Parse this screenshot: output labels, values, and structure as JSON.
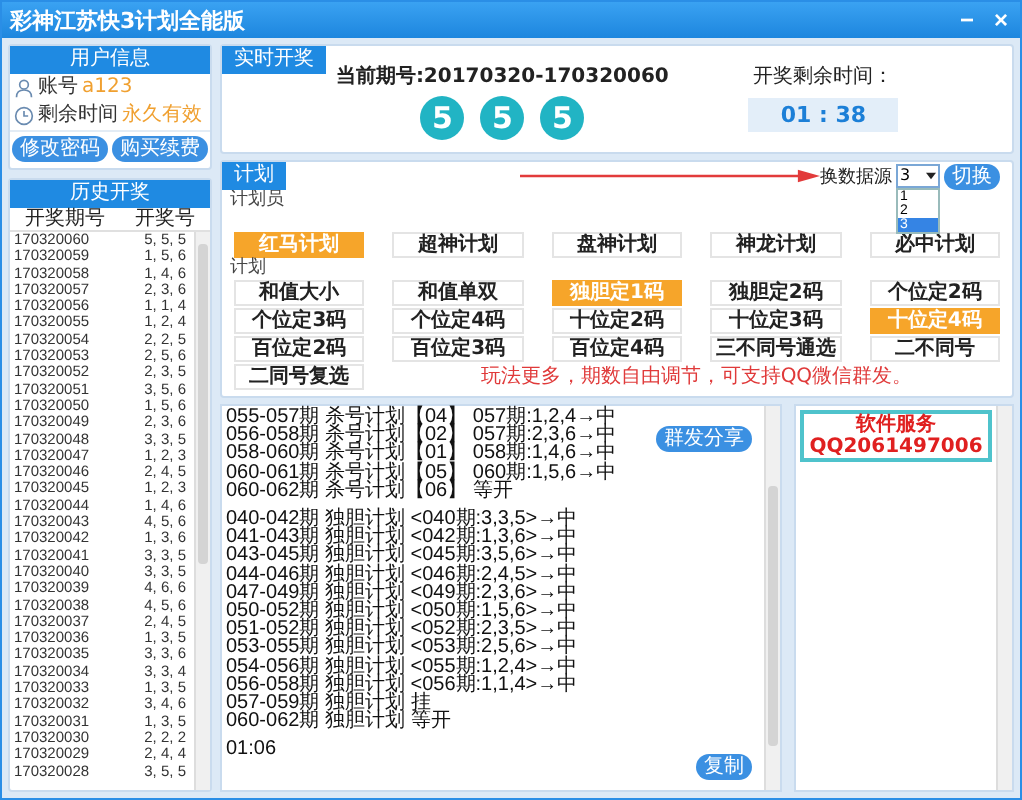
{
  "window": {
    "title": "彩神江苏快3计划全能版",
    "controls": [
      "−",
      "×"
    ]
  },
  "user_info": {
    "title": "用户信息",
    "fields": [
      {
        "kind": "user",
        "label": "账号",
        "value": "a123"
      },
      {
        "kind": "clock",
        "label": "剩余时间",
        "value": "永久有效"
      }
    ],
    "buttons": [
      "修改密码",
      "购买续费"
    ]
  },
  "history": {
    "title": "历史开奖",
    "columns": [
      "开奖期号",
      "开奖号"
    ],
    "rows": [
      [
        "170320060",
        "5, 5, 5"
      ],
      [
        "170320059",
        "1, 5, 6"
      ],
      [
        "170320058",
        "1, 4, 6"
      ],
      [
        "170320057",
        "2, 3, 6"
      ],
      [
        "170320056",
        "1, 1, 4"
      ],
      [
        "170320055",
        "1, 2, 4"
      ],
      [
        "170320054",
        "2, 2, 5"
      ],
      [
        "170320053",
        "2, 5, 6"
      ],
      [
        "170320052",
        "2, 3, 5"
      ],
      [
        "170320051",
        "3, 5, 6"
      ],
      [
        "170320050",
        "1, 5, 6"
      ],
      [
        "170320049",
        "2, 3, 6"
      ],
      [
        "170320048",
        "3, 3, 5"
      ],
      [
        "170320047",
        "1, 2, 3"
      ],
      [
        "170320046",
        "2, 4, 5"
      ],
      [
        "170320045",
        "1, 2, 3"
      ],
      [
        "170320044",
        "1, 4, 6"
      ],
      [
        "170320043",
        "4, 5, 6"
      ],
      [
        "170320042",
        "1, 3, 6"
      ],
      [
        "170320041",
        "3, 3, 5"
      ],
      [
        "170320040",
        "3, 3, 5"
      ],
      [
        "170320039",
        "4, 6, 6"
      ],
      [
        "170320038",
        "4, 5, 6"
      ],
      [
        "170320037",
        "2, 4, 5"
      ],
      [
        "170320036",
        "1, 3, 5"
      ],
      [
        "170320035",
        "3, 3, 6"
      ],
      [
        "170320034",
        "3, 3, 4"
      ],
      [
        "170320033",
        "1, 3, 5"
      ],
      [
        "170320032",
        "3, 4, 6"
      ],
      [
        "170320031",
        "1, 3, 5"
      ],
      [
        "170320030",
        "2, 2, 2"
      ],
      [
        "170320029",
        "2, 4, 4"
      ],
      [
        "170320028",
        "3, 5, 5"
      ]
    ]
  },
  "live_draw": {
    "tab": "实时开奖",
    "period_label": "当前期号:20170320-170320060",
    "balls": [
      "5",
      "5",
      "5"
    ],
    "countdown_label": "开奖剩余时间：",
    "countdown": "01 : 38"
  },
  "plan": {
    "tab": "计划",
    "source": {
      "label": "换数据源",
      "value": "3",
      "options": [
        {
          "label": "1",
          "selected": false
        },
        {
          "label": "2",
          "selected": false
        },
        {
          "label": "3",
          "selected": true
        }
      ]
    },
    "switch_button": "切换",
    "planner_label": "计划员",
    "planners": [
      {
        "label": "红马计划",
        "selected": true
      },
      {
        "label": "超神计划",
        "selected": false
      },
      {
        "label": "盘神计划",
        "selected": false
      },
      {
        "label": "神龙计划",
        "selected": false
      },
      {
        "label": "必中计划",
        "selected": false
      }
    ],
    "plan_label": "计划",
    "plans": [
      {
        "label": "和值大小",
        "selected": false
      },
      {
        "label": "和值单双",
        "selected": false
      },
      {
        "label": "独胆定1码",
        "selected": true
      },
      {
        "label": "独胆定2码",
        "selected": false
      },
      {
        "label": "个位定2码",
        "selected": false
      },
      {
        "label": "个位定3码",
        "selected": false
      },
      {
        "label": "个位定4码",
        "selected": false
      },
      {
        "label": "十位定2码",
        "selected": false
      },
      {
        "label": "十位定3码",
        "selected": false
      },
      {
        "label": "十位定4码",
        "selected": true
      },
      {
        "label": "百位定2码",
        "selected": false
      },
      {
        "label": "百位定3码",
        "selected": false
      },
      {
        "label": "百位定4码",
        "selected": false
      },
      {
        "label": "三不同号通选",
        "selected": false
      },
      {
        "label": "二不同号",
        "selected": false
      },
      {
        "label": "二同号复选",
        "selected": false
      }
    ],
    "notice": "玩法更多，期数自由调节，可支持QQ微信群发。"
  },
  "log": {
    "groups": [
      [
        "055-057期 杀号计划【04】 057期:1,2,4→中",
        "056-058期 杀号计划【02】 057期:2,3,6→中",
        "058-060期 杀号计划【01】 058期:1,4,6→中",
        "060-061期 杀号计划【05】 060期:1,5,6→中",
        "060-062期 杀号计划【06】 等开"
      ],
      [
        "040-042期 独胆计划 <040期:3,3,5>→中",
        "041-043期 独胆计划 <042期:1,3,6>→中",
        "043-045期 独胆计划 <045期:3,5,6>→中",
        "044-046期 独胆计划 <046期:2,4,5>→中",
        "047-049期 独胆计划 <049期:2,3,6>→中",
        "050-052期 独胆计划 <050期:1,5,6>→中",
        "051-052期 独胆计划 <052期:2,3,5>→中",
        "053-055期 独胆计划 <053期:2,5,6>→中",
        "054-056期 独胆计划 <055期:1,2,4>→中",
        "056-058期 独胆计划 <056期:1,1,4>→中",
        "057-059期 独胆计划 挂",
        "060-062期 独胆计划 等开"
      ],
      [
        "01:06"
      ]
    ],
    "share_button": "群发分享",
    "copy_button": "复制"
  },
  "service": {
    "text": "软件服务QQ2061497006"
  }
}
